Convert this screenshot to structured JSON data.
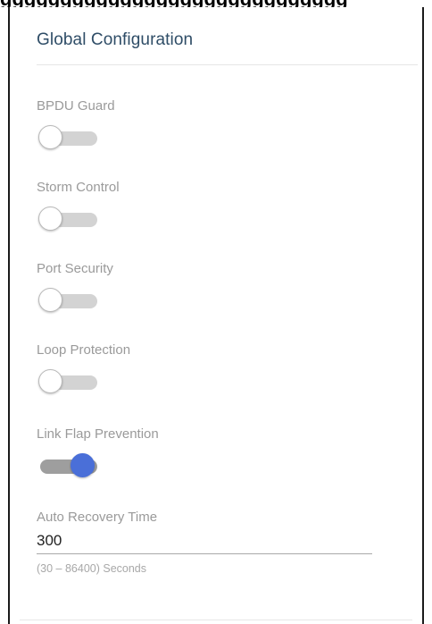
{
  "panel": {
    "title": "Global Configuration"
  },
  "settings": [
    {
      "label": "BPDU Guard",
      "enabled": false
    },
    {
      "label": "Storm Control",
      "enabled": false
    },
    {
      "label": "Port Security",
      "enabled": false
    },
    {
      "label": "Loop Protection",
      "enabled": false
    },
    {
      "label": "Link Flap Prevention",
      "enabled": true
    }
  ],
  "auto_recovery": {
    "label": "Auto Recovery Time",
    "value": "300",
    "hint": "(30 – 86400) Seconds"
  },
  "colors": {
    "title": "#2f4d67",
    "toggle_on": "#4a6fd8",
    "toggle_off_track": "#d3d3d3"
  }
}
